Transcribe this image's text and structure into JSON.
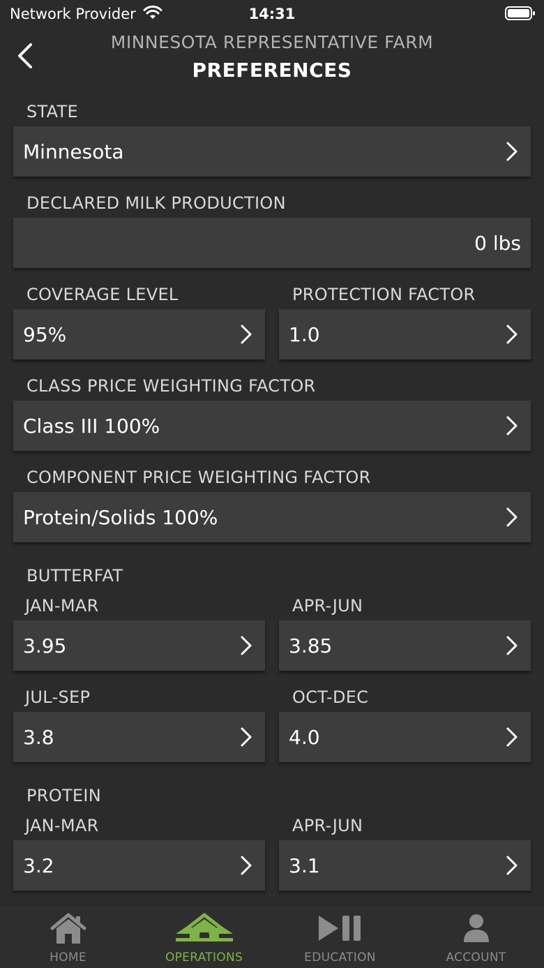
{
  "status_bar": {
    "carrier": "Network Provider",
    "time": "14:31"
  },
  "header": {
    "subtitle": "MINNESOTA REPRESENTATIVE FARM",
    "title": "PREFERENCES"
  },
  "state": {
    "label": "STATE",
    "value": "Minnesota"
  },
  "milk": {
    "label": "DECLARED MILK PRODUCTION",
    "value": "0 lbs"
  },
  "coverage": {
    "label": "COVERAGE LEVEL",
    "value": "95%"
  },
  "protection": {
    "label": "PROTECTION FACTOR",
    "value": "1.0"
  },
  "class_price": {
    "label": "CLASS PRICE WEIGHTING FACTOR",
    "value": "Class III 100%"
  },
  "component_price": {
    "label": "COMPONENT PRICE WEIGHTING FACTOR",
    "value": "Protein/Solids 100%"
  },
  "butterfat": {
    "label": "BUTTERFAT",
    "q1": {
      "label": "JAN-MAR",
      "value": "3.95"
    },
    "q2": {
      "label": "APR-JUN",
      "value": "3.85"
    },
    "q3": {
      "label": "JUL-SEP",
      "value": "3.8"
    },
    "q4": {
      "label": "OCT-DEC",
      "value": "4.0"
    }
  },
  "protein": {
    "label": "PROTEIN",
    "q1": {
      "label": "JAN-MAR",
      "value": "3.2"
    },
    "q2": {
      "label": "APR-JUN",
      "value": "3.1"
    }
  },
  "tabs": [
    {
      "label": "HOME",
      "icon": "home-icon"
    },
    {
      "label": "OPERATIONS",
      "icon": "operations-icon",
      "active": true
    },
    {
      "label": "EDUCATION",
      "icon": "play-pause-icon"
    },
    {
      "label": "ACCOUNT",
      "icon": "person-icon"
    }
  ],
  "colors": {
    "background": "#2b2b2b",
    "field": "#3d3d3d",
    "accent": "#7fb347"
  }
}
